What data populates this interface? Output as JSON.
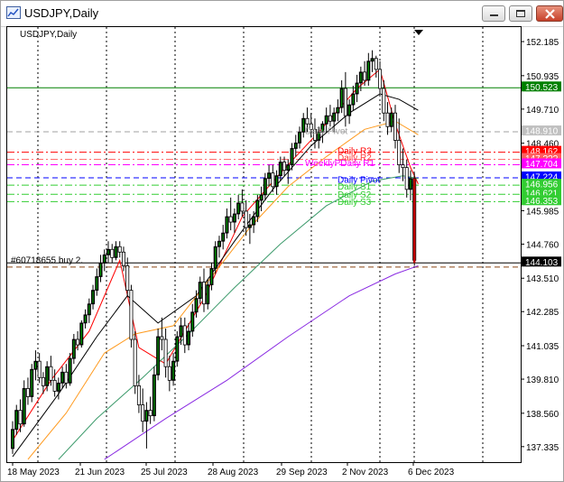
{
  "window": {
    "title": "USDJPY,Daily"
  },
  "chart_data": {
    "type": "candlestick",
    "symbol_label": "USDJPY,Daily",
    "ylim": [
      136.8,
      152.75
    ],
    "y_ticks": [
      "152.185",
      "150.935",
      "149.710",
      "148.460",
      "147.235",
      "145.985",
      "144.760",
      "143.510",
      "142.285",
      "141.035",
      "139.810",
      "138.560",
      "137.335"
    ],
    "x_ticks": [
      "18 May 2023",
      "21 Jun 2023",
      "25 Jul 2023",
      "28 Aug 2023",
      "29 Sep 2023",
      "2 Nov 2023",
      "6 Dec 2023"
    ],
    "price_tags": [
      {
        "label": "150.523",
        "value": 150.523,
        "color": "#008000",
        "text_color": "#ffffff"
      },
      {
        "label": "148.910",
        "value": 148.91,
        "color": "#c0c0c0",
        "text_color": "#ffffff"
      },
      {
        "label": "148.162",
        "value": 148.162,
        "color": "#ff0000",
        "text_color": "#ffffff"
      },
      {
        "label": "147.???",
        "value": 147.9,
        "color": "#ff5f5f",
        "text_color": "#ffffff"
      },
      {
        "label": "147.704",
        "value": 147.704,
        "color": "#ff00ff",
        "text_color": "#ffffff"
      },
      {
        "label": "147.224",
        "value": 147.224,
        "color": "#0000ff",
        "text_color": "#ffffff"
      },
      {
        "label": "146.956",
        "value": 146.956,
        "color": "#32cd32",
        "text_color": "#ffffff"
      },
      {
        "label": "146.621",
        "value": 146.621,
        "color": "#32cd32",
        "text_color": "#ffffff"
      },
      {
        "label": "146.353",
        "value": 146.353,
        "color": "#32cd32",
        "text_color": "#ffffff"
      },
      {
        "label": "144.103",
        "value": 144.103,
        "color": "#000000",
        "text_color": "#ffffff"
      }
    ],
    "horizontal_lines": [
      {
        "value": 150.523,
        "color": "#008000",
        "style": "solid"
      },
      {
        "value": 148.91,
        "color": "#a0a0a0",
        "style": "dash"
      },
      {
        "value": 148.162,
        "color": "#ff0000",
        "style": "dashdot"
      },
      {
        "value": 147.9,
        "color": "#ff6060",
        "style": "dashdot"
      },
      {
        "value": 147.704,
        "color": "#ff00ff",
        "style": "dashdot"
      },
      {
        "value": 147.224,
        "color": "#0000ff",
        "style": "dash"
      },
      {
        "value": 146.956,
        "color": "#32cd32",
        "style": "dashdot"
      },
      {
        "value": 146.621,
        "color": "#32cd32",
        "style": "dashdot"
      },
      {
        "value": 146.353,
        "color": "#32cd32",
        "style": "dashdot"
      },
      {
        "value": 144.103,
        "color": "#000000",
        "style": "solid"
      },
      {
        "value": 143.95,
        "color": "#8b4513",
        "style": "dash"
      }
    ],
    "annotations": [
      {
        "text": "Daily R3",
        "color": "#ff0000",
        "value": 148.1
      },
      {
        "text": "Daily R2",
        "color": "#ff4040",
        "value": 147.85
      },
      {
        "text": "WeeklyPDaily R1",
        "color": "#ff00ff",
        "value": 147.65
      },
      {
        "text": "Daily Pivot",
        "color": "#0000ff",
        "value": 147.05
      },
      {
        "text": "Daily S1",
        "color": "#32cd32",
        "value": 146.8
      },
      {
        "text": "Daily S2",
        "color": "#32cd32",
        "value": 146.5
      },
      {
        "text": "Daily S3",
        "color": "#32cd32",
        "value": 146.23
      },
      {
        "text": "Daily Pivot",
        "color": "#a0a0a0",
        "value": 148.83
      },
      {
        "text": "#60718655 buy 2.",
        "color": "#000000",
        "value": 144.1
      }
    ],
    "candles": [
      [
        137.3,
        138.3,
        137.1,
        138.0
      ],
      [
        138.0,
        138.9,
        137.8,
        138.7
      ],
      [
        138.7,
        139.1,
        137.9,
        138.2
      ],
      [
        138.2,
        139.8,
        138.1,
        139.5
      ],
      [
        139.5,
        139.9,
        138.9,
        139.2
      ],
      [
        139.2,
        140.4,
        139.0,
        140.2
      ],
      [
        140.2,
        140.9,
        139.8,
        140.5
      ],
      [
        140.5,
        140.8,
        139.7,
        139.9
      ],
      [
        139.9,
        140.1,
        139.3,
        139.6
      ],
      [
        139.6,
        140.5,
        139.4,
        140.3
      ],
      [
        140.3,
        140.7,
        139.6,
        139.8
      ],
      [
        139.8,
        140.2,
        139.2,
        139.4
      ],
      [
        139.4,
        139.9,
        139.1,
        139.7
      ],
      [
        139.7,
        140.3,
        139.5,
        140.1
      ],
      [
        140.1,
        140.4,
        139.5,
        139.7
      ],
      [
        139.7,
        140.8,
        139.6,
        140.6
      ],
      [
        140.6,
        141.5,
        140.4,
        141.3
      ],
      [
        141.3,
        141.6,
        140.9,
        141.1
      ],
      [
        141.1,
        142.0,
        141.0,
        141.9
      ],
      [
        141.9,
        142.4,
        141.7,
        142.2
      ],
      [
        142.2,
        142.8,
        141.9,
        142.6
      ],
      [
        142.6,
        143.3,
        142.4,
        143.1
      ],
      [
        143.1,
        143.9,
        142.9,
        143.6
      ],
      [
        143.6,
        144.4,
        143.4,
        144.1
      ],
      [
        144.1,
        144.6,
        143.8,
        144.4
      ],
      [
        144.4,
        144.9,
        144.1,
        144.6
      ],
      [
        144.6,
        144.8,
        144.1,
        144.3
      ],
      [
        144.3,
        144.9,
        144.2,
        144.7
      ],
      [
        144.7,
        144.9,
        144.3,
        144.5
      ],
      [
        144.5,
        144.7,
        143.8,
        144.0
      ],
      [
        144.0,
        144.3,
        142.9,
        143.1
      ],
      [
        143.1,
        143.3,
        141.0,
        141.3
      ],
      [
        141.3,
        141.6,
        139.3,
        139.6
      ],
      [
        139.6,
        140.0,
        138.6,
        138.9
      ],
      [
        138.9,
        139.5,
        137.9,
        138.3
      ],
      [
        138.3,
        139.0,
        137.3,
        138.7
      ],
      [
        138.7,
        139.2,
        138.2,
        138.5
      ],
      [
        138.5,
        140.3,
        138.3,
        140.0
      ],
      [
        140.0,
        141.7,
        139.8,
        141.4
      ],
      [
        141.4,
        142.1,
        140.9,
        141.3
      ],
      [
        141.3,
        141.7,
        139.9,
        140.3
      ],
      [
        140.3,
        140.7,
        139.4,
        139.8
      ],
      [
        139.8,
        140.8,
        139.6,
        140.5
      ],
      [
        140.5,
        141.6,
        140.3,
        141.4
      ],
      [
        141.4,
        142.1,
        141.1,
        141.8
      ],
      [
        141.8,
        142.1,
        140.8,
        141.1
      ],
      [
        141.1,
        141.9,
        140.9,
        141.6
      ],
      [
        141.6,
        142.6,
        141.4,
        142.3
      ],
      [
        142.3,
        143.1,
        142.1,
        142.8
      ],
      [
        142.8,
        143.6,
        142.6,
        143.4
      ],
      [
        143.4,
        143.9,
        142.3,
        142.6
      ],
      [
        142.6,
        143.5,
        142.4,
        143.3
      ],
      [
        143.3,
        144.1,
        143.1,
        143.9
      ],
      [
        143.9,
        144.9,
        143.7,
        144.7
      ],
      [
        144.7,
        145.1,
        144.3,
        144.9
      ],
      [
        144.9,
        145.5,
        144.6,
        145.2
      ],
      [
        145.2,
        146.1,
        145.0,
        145.8
      ],
      [
        145.8,
        146.5,
        145.3,
        145.6
      ],
      [
        145.6,
        146.1,
        145.2,
        145.9
      ],
      [
        145.9,
        146.6,
        145.7,
        146.3
      ],
      [
        146.3,
        146.8,
        145.8,
        146.0
      ],
      [
        146.0,
        146.4,
        145.1,
        145.4
      ],
      [
        145.4,
        145.9,
        144.8,
        145.5
      ],
      [
        145.5,
        146.0,
        145.2,
        145.8
      ],
      [
        145.8,
        146.6,
        145.6,
        146.4
      ],
      [
        146.4,
        146.9,
        146.0,
        146.6
      ],
      [
        146.6,
        147.4,
        146.4,
        147.2
      ],
      [
        147.2,
        147.7,
        146.9,
        147.4
      ],
      [
        147.4,
        147.7,
        146.7,
        146.9
      ],
      [
        146.9,
        147.5,
        146.6,
        147.3
      ],
      [
        147.3,
        148.0,
        147.1,
        147.8
      ],
      [
        147.8,
        148.0,
        147.3,
        147.5
      ],
      [
        147.5,
        147.9,
        147.0,
        147.7
      ],
      [
        147.7,
        148.5,
        147.5,
        148.3
      ],
      [
        148.3,
        148.8,
        148.0,
        148.5
      ],
      [
        148.5,
        149.1,
        148.3,
        148.9
      ],
      [
        148.9,
        149.6,
        148.7,
        149.4
      ],
      [
        149.4,
        149.8,
        148.9,
        149.2
      ],
      [
        149.2,
        149.6,
        148.7,
        149.0
      ],
      [
        149.0,
        149.4,
        148.3,
        148.6
      ],
      [
        148.6,
        149.1,
        148.3,
        148.9
      ],
      [
        148.9,
        149.3,
        148.5,
        149.2
      ],
      [
        149.2,
        149.8,
        148.9,
        149.5
      ],
      [
        149.5,
        149.9,
        149.1,
        149.3
      ],
      [
        149.3,
        149.8,
        148.9,
        149.6
      ],
      [
        149.6,
        150.1,
        149.3,
        149.8
      ],
      [
        149.8,
        150.8,
        149.6,
        150.5
      ],
      [
        150.5,
        151.1,
        149.1,
        149.5
      ],
      [
        149.5,
        150.1,
        149.2,
        149.9
      ],
      [
        149.9,
        150.6,
        149.7,
        150.3
      ],
      [
        150.3,
        151.0,
        150.0,
        150.7
      ],
      [
        150.7,
        151.3,
        150.4,
        151.1
      ],
      [
        151.1,
        151.5,
        150.6,
        150.8
      ],
      [
        150.8,
        151.8,
        150.6,
        151.5
      ],
      [
        151.5,
        151.9,
        151.1,
        151.6
      ],
      [
        151.6,
        151.7,
        150.9,
        151.2
      ],
      [
        151.2,
        151.5,
        150.3,
        150.5
      ],
      [
        150.5,
        150.8,
        149.3,
        149.6
      ],
      [
        149.6,
        150.0,
        148.8,
        149.1
      ],
      [
        149.1,
        149.8,
        148.9,
        149.6
      ],
      [
        149.6,
        149.9,
        148.3,
        148.6
      ],
      [
        148.6,
        149.4,
        147.4,
        147.7
      ],
      [
        147.7,
        148.3,
        147.1,
        147.6
      ],
      [
        147.6,
        147.9,
        146.5,
        146.8
      ],
      [
        146.8,
        147.5,
        146.4,
        147.2
      ],
      [
        147.2,
        147.4,
        144.0,
        144.2
      ]
    ],
    "ma_series": [
      {
        "name": "red",
        "color": "#ff0000",
        "points": [
          [
            0,
            137.6
          ],
          [
            10,
            139.8
          ],
          [
            20,
            141.6
          ],
          [
            28,
            144.2
          ],
          [
            33,
            141.0
          ],
          [
            40,
            140.4
          ],
          [
            50,
            142.8
          ],
          [
            60,
            145.8
          ],
          [
            70,
            147.4
          ],
          [
            80,
            148.9
          ],
          [
            90,
            150.5
          ],
          [
            96,
            151.2
          ],
          [
            100,
            149.2
          ],
          [
            104,
            147.6
          ],
          [
            106,
            147.0
          ]
        ]
      },
      {
        "name": "black",
        "color": "#000000",
        "points": [
          [
            0,
            137.0
          ],
          [
            12,
            139.3
          ],
          [
            22,
            141.4
          ],
          [
            30,
            142.9
          ],
          [
            38,
            141.9
          ],
          [
            48,
            142.9
          ],
          [
            58,
            144.9
          ],
          [
            68,
            146.8
          ],
          [
            78,
            148.4
          ],
          [
            88,
            149.6
          ],
          [
            96,
            150.3
          ],
          [
            101,
            150.1
          ],
          [
            106,
            149.7
          ]
        ]
      },
      {
        "name": "orange",
        "color": "#ff9a1e",
        "points": [
          [
            4,
            136.9
          ],
          [
            14,
            138.6
          ],
          [
            24,
            140.8
          ],
          [
            32,
            141.5
          ],
          [
            42,
            141.8
          ],
          [
            52,
            143.6
          ],
          [
            62,
            145.4
          ],
          [
            72,
            146.9
          ],
          [
            82,
            148.0
          ],
          [
            92,
            149.0
          ],
          [
            100,
            149.3
          ],
          [
            106,
            148.8
          ]
        ]
      },
      {
        "name": "seagreen",
        "color": "#3c9a6b",
        "points": [
          [
            12,
            136.9
          ],
          [
            22,
            138.4
          ],
          [
            34,
            139.9
          ],
          [
            46,
            141.5
          ],
          [
            58,
            143.2
          ],
          [
            70,
            144.8
          ],
          [
            82,
            146.2
          ],
          [
            94,
            147.1
          ],
          [
            102,
            147.3
          ],
          [
            106,
            147.2
          ]
        ]
      },
      {
        "name": "purple",
        "color": "#8a2be2",
        "points": [
          [
            24,
            136.9
          ],
          [
            40,
            138.4
          ],
          [
            56,
            139.8
          ],
          [
            72,
            141.4
          ],
          [
            88,
            142.9
          ],
          [
            100,
            143.7
          ],
          [
            106,
            144.0
          ]
        ]
      }
    ]
  }
}
